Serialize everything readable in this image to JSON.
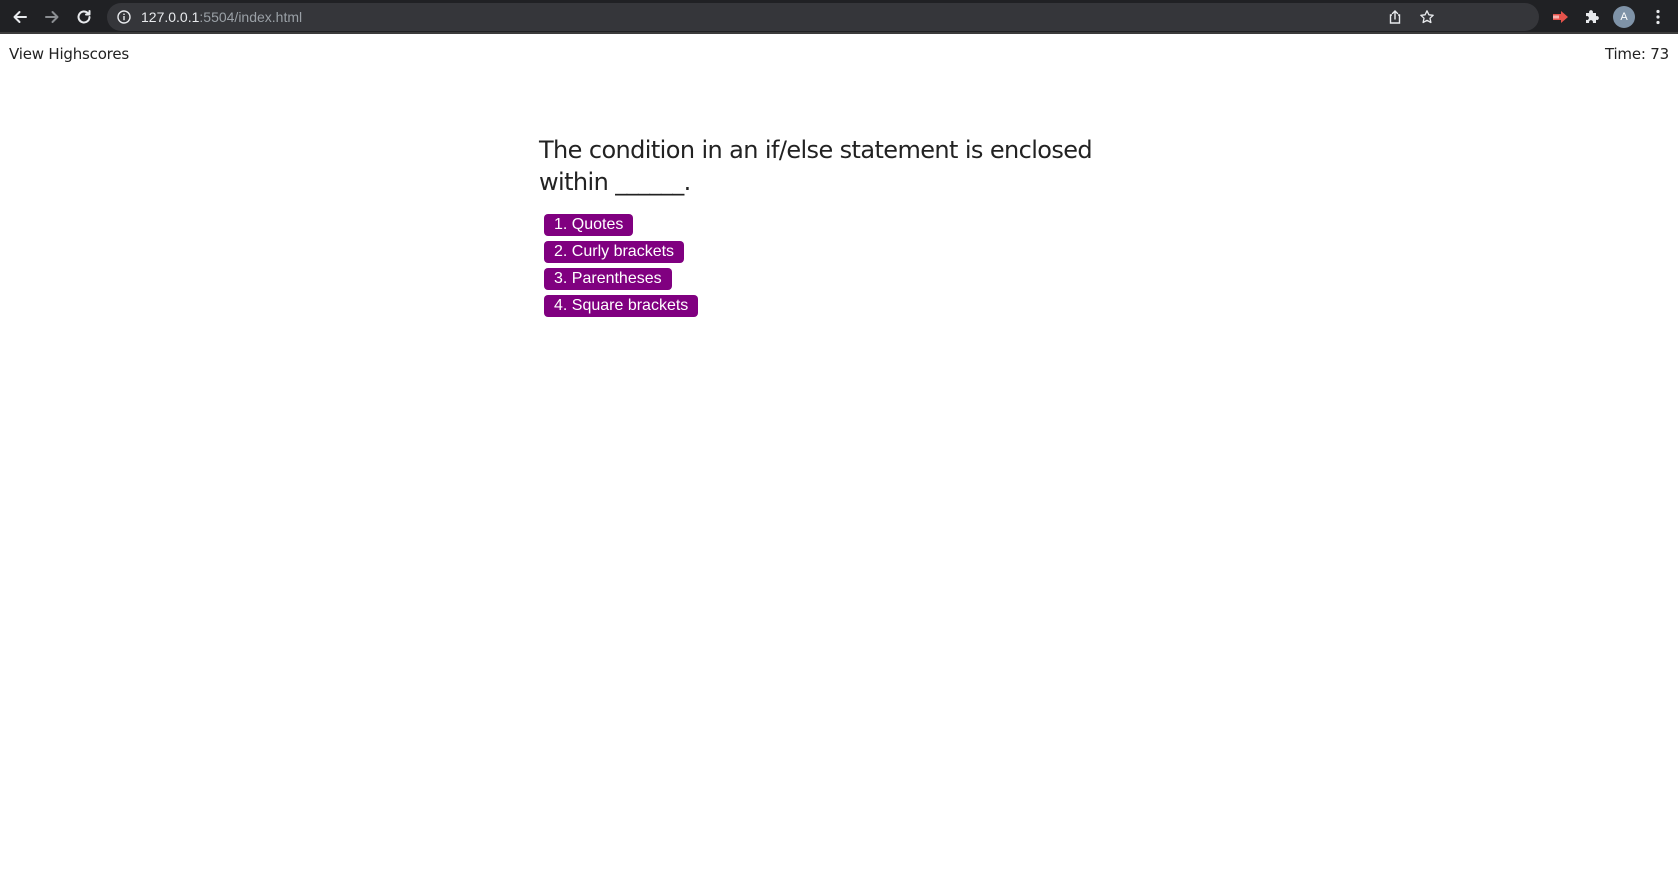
{
  "browser": {
    "url_host": "127.0.0.1",
    "url_path": ":5504/index.html",
    "avatar_initial": "A",
    "icons": [
      "back-arrow-icon",
      "forward-arrow-icon",
      "reload-icon",
      "site-info-icon",
      "share-icon",
      "bookmark-star-icon",
      "extension-red-icon",
      "extensions-puzzle-icon",
      "kebab-menu-icon"
    ]
  },
  "header": {
    "highscores_label": "View Highscores",
    "timer_label": "Time: 73"
  },
  "quiz": {
    "question": "The condition in an if/else statement is enclosed within ______.",
    "choices": [
      {
        "label": "1. Quotes"
      },
      {
        "label": "2. Curly brackets"
      },
      {
        "label": "3. Parentheses"
      },
      {
        "label": "4. Square brackets"
      }
    ],
    "accent_color": "#800080"
  }
}
